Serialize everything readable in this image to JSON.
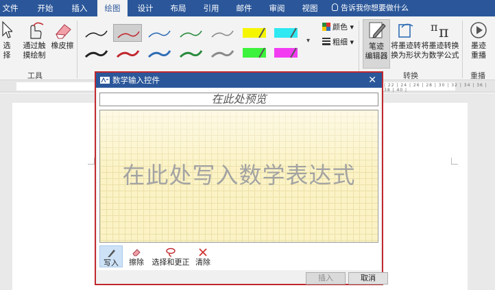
{
  "tabs": [
    {
      "label": "文件",
      "active": false
    },
    {
      "label": "开始",
      "active": false
    },
    {
      "label": "插入",
      "active": false
    },
    {
      "label": "绘图",
      "active": true
    },
    {
      "label": "设计",
      "active": false
    },
    {
      "label": "布局",
      "active": false
    },
    {
      "label": "引用",
      "active": false
    },
    {
      "label": "邮件",
      "active": false
    },
    {
      "label": "审阅",
      "active": false
    },
    {
      "label": "视图",
      "active": false
    }
  ],
  "tell_me": "告诉我你想要做什么",
  "ribbon": {
    "select": {
      "line1": "选",
      "line2": "择"
    },
    "touch_draw": {
      "line1": "通过触",
      "line2": "摸绘制"
    },
    "eraser": "橡皮擦",
    "tools_group": "工具",
    "pens": [
      {
        "color": "#222222",
        "selected": false
      },
      {
        "color": "#c0282d",
        "selected": true
      },
      {
        "color": "#2f6db5",
        "selected": false
      },
      {
        "color": "#2a8a3c",
        "selected": false
      },
      {
        "color": "#8a8a8a",
        "selected": false
      },
      {
        "color": "#f5f500",
        "selected": false,
        "highlighter": true
      },
      {
        "color": "#2ee8f2",
        "selected": false,
        "highlighter": true
      },
      {
        "color": "#222222",
        "selected": false
      },
      {
        "color": "#c0282d",
        "selected": false
      },
      {
        "color": "#2f6db5",
        "selected": false
      },
      {
        "color": "#2a8a3c",
        "selected": false
      },
      {
        "color": "#8a8a8a",
        "selected": false
      },
      {
        "color": "#3cf23c",
        "selected": false,
        "highlighter": true
      },
      {
        "color": "#f23cf2",
        "selected": false,
        "highlighter": true
      }
    ],
    "color_btn": "颜色",
    "thickness_btn": "粗细",
    "ink_editor": {
      "line1": "笔迹",
      "line2": "编辑器"
    },
    "ink_to_shape": {
      "line1": "将墨迹转",
      "line2": "换为形状"
    },
    "ink_to_math": {
      "line1": "将墨迹转换",
      "line2": "为数学公式"
    },
    "convert_group": "转换",
    "ink_replay": {
      "line1": "墨迹",
      "line2": "重播"
    },
    "replay_group": "重播"
  },
  "ruler_ticks": "| 22 | 24 | 26 | 28 | 30 | 32 | 34 | 36 | 38 | 40 |",
  "dialog": {
    "title": "数学输入控件",
    "close": "✕",
    "preview": "在此处预览",
    "hint": "在此处写入数学表达式",
    "tools": [
      {
        "label": "写入",
        "icon": "pen-icon",
        "active": true
      },
      {
        "label": "擦除",
        "icon": "eraser-icon",
        "active": false
      },
      {
        "label": "选择和更正",
        "icon": "lasso-icon",
        "active": false
      },
      {
        "label": "清除",
        "icon": "clear-icon",
        "active": false
      }
    ],
    "insert": "插入",
    "cancel": "取消"
  },
  "colors": {
    "accent": "#2b579a",
    "dialog_border": "#c1272d",
    "pad": "#fbf3c6"
  }
}
